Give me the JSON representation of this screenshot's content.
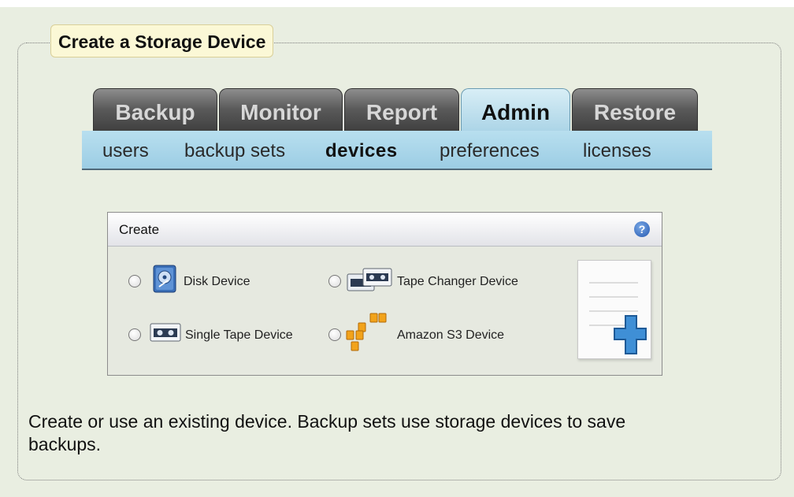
{
  "legend": {
    "title": "Create a Storage Device"
  },
  "tabs": [
    {
      "label": "Backup",
      "active": false
    },
    {
      "label": "Monitor",
      "active": false
    },
    {
      "label": "Report",
      "active": false
    },
    {
      "label": "Admin",
      "active": true
    },
    {
      "label": "Restore",
      "active": false
    }
  ],
  "subnav": [
    {
      "label": "users",
      "active": false
    },
    {
      "label": "backup sets",
      "active": false
    },
    {
      "label": "devices",
      "active": true
    },
    {
      "label": "preferences",
      "active": false
    },
    {
      "label": "licenses",
      "active": false
    }
  ],
  "panel": {
    "title": "Create",
    "help_icon": "help-icon",
    "options": [
      {
        "label": "Disk Device",
        "icon": "disk-device-icon",
        "selected": false
      },
      {
        "label": "Tape Changer Device",
        "icon": "tape-changer-icon",
        "selected": false
      },
      {
        "label": "Single Tape Device",
        "icon": "single-tape-icon",
        "selected": false
      },
      {
        "label": "Amazon S3 Device",
        "icon": "amazon-s3-icon",
        "selected": false
      }
    ],
    "create_graphic": "new-document-plus-icon"
  },
  "description": {
    "line1": "Create or use an existing device. Backup sets use storage devices to save",
    "line2": "backups."
  },
  "colors": {
    "background": "#e9eee1",
    "tab_dark": "#4a4a4a",
    "tab_active": "#bfe2f1",
    "subnav": "#a9d6ea",
    "legend_bg": "#fbf8d6"
  }
}
